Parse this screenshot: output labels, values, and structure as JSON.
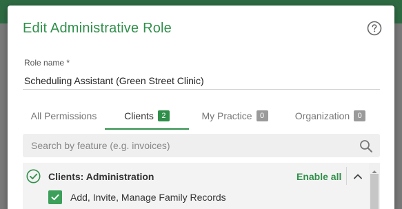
{
  "modal": {
    "title": "Edit Administrative Role"
  },
  "role": {
    "label": "Role name *",
    "value": "Scheduling Assistant (Green Street Clinic)"
  },
  "tabs": [
    {
      "label": "All Permissions",
      "badge": null,
      "active": false
    },
    {
      "label": "Clients",
      "badge": "2",
      "active": true
    },
    {
      "label": "My Practice",
      "badge": "0",
      "active": false
    },
    {
      "label": "Organization",
      "badge": "0",
      "active": false
    }
  ],
  "search": {
    "placeholder": "Search by feature (e.g. invoices)",
    "value": ""
  },
  "group": {
    "title": "Clients: Administration",
    "enable_all": "Enable all",
    "permissions": [
      {
        "label": "Add, Invite, Manage Family Records",
        "checked": true
      }
    ]
  },
  "colors": {
    "brand_green": "#2f8f4a",
    "checkbox_green": "#3ca05a",
    "topbar": "#2e6b43"
  },
  "icons": {
    "help": "help-circle-icon",
    "search": "search-icon",
    "group_status": "check-circle-icon",
    "collapse": "chevron-up-icon",
    "checkbox": "check-icon"
  }
}
